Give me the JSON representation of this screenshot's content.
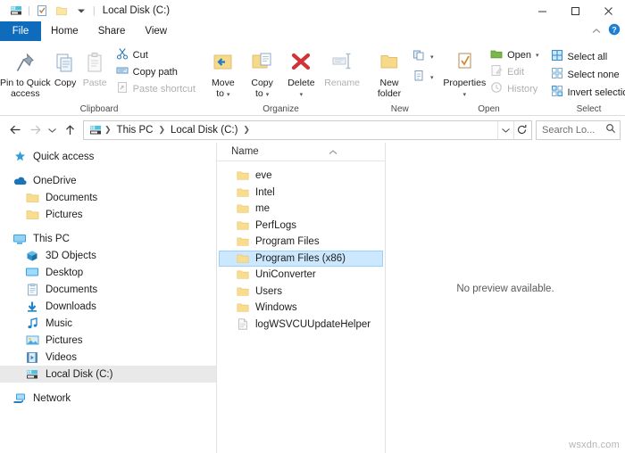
{
  "window": {
    "title": "Local Disk (C:)",
    "quick_access_icons": [
      "drive-icon",
      "properties-icon",
      "new-folder-icon",
      "customize-qat-icon"
    ],
    "controls": {
      "minimize": "minimize-icon",
      "maximize": "maximize-icon",
      "close": "close-icon"
    }
  },
  "tabs": {
    "file": "File",
    "items": [
      "Home",
      "Share",
      "View"
    ],
    "active": "Home",
    "collapse_icon": "chevron-up-icon",
    "help_icon": "help-icon"
  },
  "ribbon": {
    "groups": [
      {
        "label": "Clipboard",
        "big": [
          {
            "label": "Pin to Quick\naccess",
            "line1": "Pin to Quick",
            "line2": "access",
            "icon": "pin-icon",
            "enabled": true
          },
          {
            "label": "Copy",
            "line1": "Copy",
            "line2": "",
            "icon": "copy-icon",
            "enabled": true
          },
          {
            "label": "Paste",
            "line1": "Paste",
            "line2": "",
            "icon": "paste-icon",
            "enabled": false
          }
        ],
        "small": [
          {
            "label": "Cut",
            "icon": "cut-icon",
            "enabled": true
          },
          {
            "label": "Copy path",
            "icon": "copy-path-icon",
            "enabled": true
          },
          {
            "label": "Paste shortcut",
            "icon": "paste-shortcut-icon",
            "enabled": false
          }
        ]
      },
      {
        "label": "Organize",
        "big": [
          {
            "line1": "Move",
            "line2": "to",
            "icon": "move-to-icon",
            "enabled": true,
            "dropdown": true
          },
          {
            "line1": "Copy",
            "line2": "to",
            "icon": "copy-to-icon",
            "enabled": true,
            "dropdown": true
          },
          {
            "line1": "Delete",
            "line2": "",
            "icon": "delete-icon",
            "enabled": true,
            "dropdown": true
          },
          {
            "line1": "Rename",
            "line2": "",
            "icon": "rename-icon",
            "enabled": false
          }
        ],
        "small": []
      },
      {
        "label": "New",
        "big": [
          {
            "line1": "New",
            "line2": "folder",
            "icon": "new-folder-icon",
            "enabled": true
          }
        ],
        "small": [
          {
            "label": "",
            "icon": "new-item-icon",
            "enabled": true,
            "dropdown": true
          },
          {
            "label": "",
            "icon": "easy-access-icon",
            "enabled": true,
            "dropdown": true
          }
        ]
      },
      {
        "label": "Open",
        "big": [
          {
            "line1": "Properties",
            "line2": "",
            "icon": "properties-icon",
            "enabled": true,
            "dropdown": true
          }
        ],
        "small": [
          {
            "label": "Open",
            "icon": "open-icon",
            "enabled": true,
            "dropdown": true
          },
          {
            "label": "Edit",
            "icon": "edit-icon",
            "enabled": false
          },
          {
            "label": "History",
            "icon": "history-icon",
            "enabled": false
          }
        ]
      },
      {
        "label": "Select",
        "big": [],
        "small": [
          {
            "label": "Select all",
            "icon": "select-all-icon",
            "enabled": true
          },
          {
            "label": "Select none",
            "icon": "select-none-icon",
            "enabled": true
          },
          {
            "label": "Invert selection",
            "icon": "invert-selection-icon",
            "enabled": true
          }
        ]
      }
    ]
  },
  "address": {
    "back_icon": "back-arrow-icon",
    "forward_icon": "forward-arrow-icon",
    "recent_icon": "chevron-down-icon",
    "up_icon": "up-arrow-icon",
    "path_icon": "drive-icon",
    "crumbs": [
      "This PC",
      "Local Disk (C:)"
    ],
    "dropdown_icon": "chevron-down-icon",
    "refresh_icon": "refresh-icon"
  },
  "search": {
    "placeholder": "Search Lo...",
    "icon": "search-icon"
  },
  "navpane": {
    "items": [
      {
        "label": "Quick access",
        "icon": "star-pin-icon",
        "indent": 0,
        "selected": false,
        "gap_after": true
      },
      {
        "label": "OneDrive",
        "icon": "onedrive-cloud-icon",
        "indent": 0,
        "selected": false
      },
      {
        "label": "Documents",
        "icon": "folder-icon",
        "indent": 1,
        "selected": false
      },
      {
        "label": "Pictures",
        "icon": "folder-icon",
        "indent": 1,
        "selected": false,
        "gap_after": true
      },
      {
        "label": "This PC",
        "icon": "this-pc-icon",
        "indent": 0,
        "selected": false
      },
      {
        "label": "3D Objects",
        "icon": "3d-objects-icon",
        "indent": 1,
        "selected": false
      },
      {
        "label": "Desktop",
        "icon": "desktop-icon",
        "indent": 1,
        "selected": false
      },
      {
        "label": "Documents",
        "icon": "documents-icon",
        "indent": 1,
        "selected": false
      },
      {
        "label": "Downloads",
        "icon": "downloads-icon",
        "indent": 1,
        "selected": false
      },
      {
        "label": "Music",
        "icon": "music-icon",
        "indent": 1,
        "selected": false
      },
      {
        "label": "Pictures",
        "icon": "pictures-icon",
        "indent": 1,
        "selected": false
      },
      {
        "label": "Videos",
        "icon": "videos-icon",
        "indent": 1,
        "selected": false
      },
      {
        "label": "Local Disk (C:)",
        "icon": "drive-icon",
        "indent": 1,
        "selected": true,
        "gap_after": true
      },
      {
        "label": "Network",
        "icon": "network-icon",
        "indent": 0,
        "selected": false
      }
    ]
  },
  "filelist": {
    "column_header": "Name",
    "sort_indicator": "ascending",
    "rows": [
      {
        "name": "eve",
        "type": "folder",
        "selected": false
      },
      {
        "name": "Intel",
        "type": "folder",
        "selected": false
      },
      {
        "name": "me",
        "type": "folder",
        "selected": false
      },
      {
        "name": "PerfLogs",
        "type": "folder",
        "selected": false
      },
      {
        "name": "Program Files",
        "type": "folder",
        "selected": false
      },
      {
        "name": "Program Files (x86)",
        "type": "folder",
        "selected": true
      },
      {
        "name": "UniConverter",
        "type": "folder",
        "selected": false
      },
      {
        "name": "Users",
        "type": "folder",
        "selected": false
      },
      {
        "name": "Windows",
        "type": "folder",
        "selected": false
      },
      {
        "name": "logWSVCUUpdateHelper",
        "type": "file",
        "selected": false
      }
    ]
  },
  "preview": {
    "message": "No preview available."
  },
  "scrollbar": {
    "left_arrow": "chevron-left-icon",
    "right_arrow": "chevron-right-icon"
  },
  "watermark": "wsxdn.com",
  "colors": {
    "accent": "#0f6cbd",
    "selection_fill": "#cce8ff",
    "selection_border": "#99d1ff",
    "nav_selection": "#e9e9e9",
    "folder": "#f8dc8f",
    "delete_red": "#d13438"
  }
}
